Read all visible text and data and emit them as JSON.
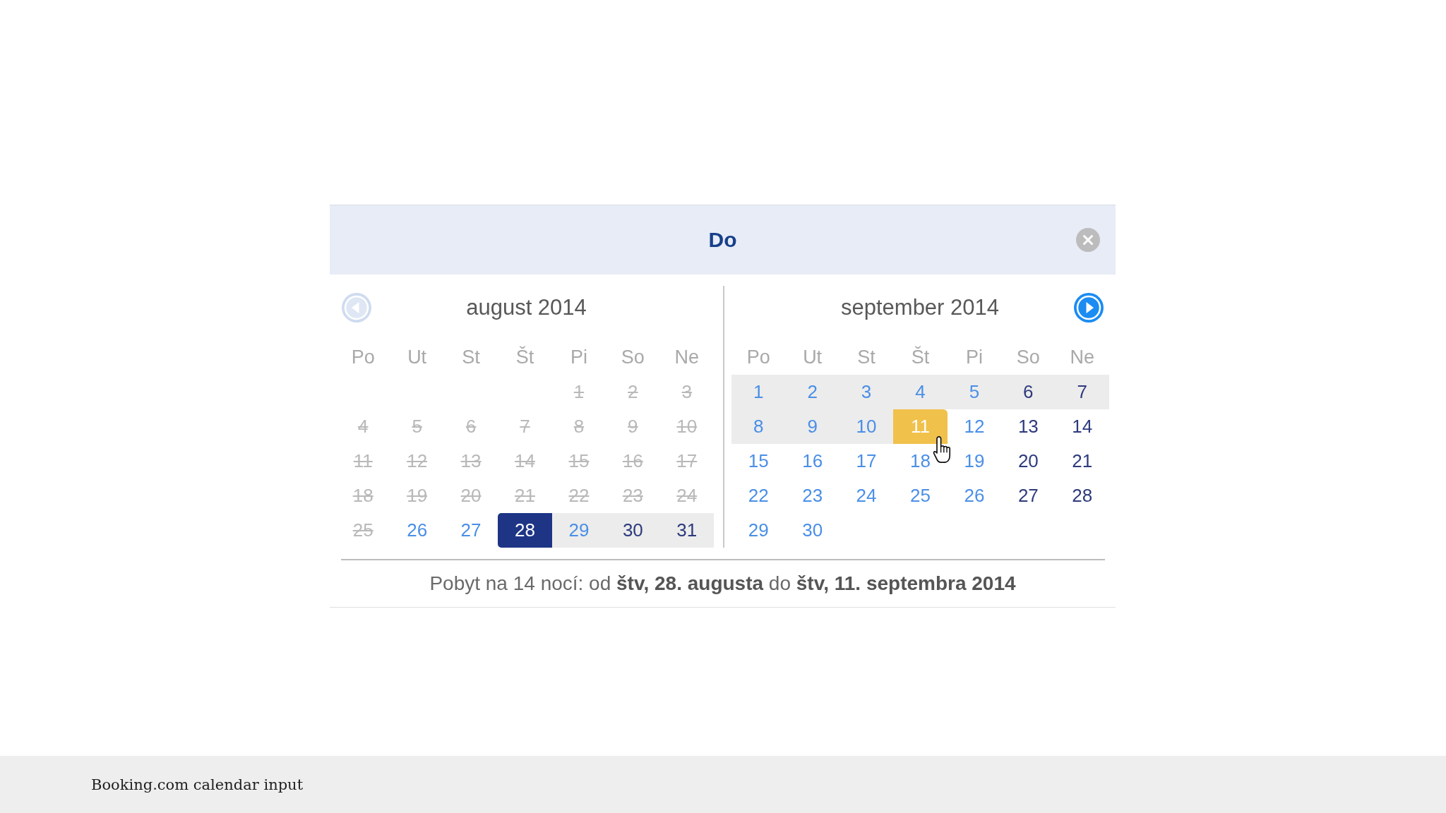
{
  "picker": {
    "title": "Do"
  },
  "navigation": {
    "previous": {
      "disabled": true
    },
    "next": {
      "disabled": false
    }
  },
  "months": [
    {
      "title": "august 2014",
      "weekdays": [
        "Po",
        "Ut",
        "St",
        "Št",
        "Pi",
        "So",
        "Ne"
      ],
      "weeks": [
        [
          {
            "day": "1",
            "kind": "past",
            "in_range": false
          },
          {
            "day": "2",
            "kind": "past",
            "in_range": false
          },
          {
            "day": "3",
            "kind": "past",
            "in_range": false
          }
        ],
        [
          {
            "day": "4",
            "kind": "past",
            "in_range": false
          },
          {
            "day": "5",
            "kind": "past",
            "in_range": false
          },
          {
            "day": "6",
            "kind": "past",
            "in_range": false
          },
          {
            "day": "7",
            "kind": "past",
            "in_range": false
          },
          {
            "day": "8",
            "kind": "past",
            "in_range": false
          },
          {
            "day": "9",
            "kind": "past",
            "in_range": false
          },
          {
            "day": "10",
            "kind": "past",
            "in_range": false
          }
        ],
        [
          {
            "day": "11",
            "kind": "past",
            "in_range": false
          },
          {
            "day": "12",
            "kind": "past",
            "in_range": false
          },
          {
            "day": "13",
            "kind": "past",
            "in_range": false
          },
          {
            "day": "14",
            "kind": "past",
            "in_range": false
          },
          {
            "day": "15",
            "kind": "past",
            "in_range": false
          },
          {
            "day": "16",
            "kind": "past",
            "in_range": false
          },
          {
            "day": "17",
            "kind": "past",
            "in_range": false
          }
        ],
        [
          {
            "day": "18",
            "kind": "past",
            "in_range": false
          },
          {
            "day": "19",
            "kind": "past",
            "in_range": false
          },
          {
            "day": "20",
            "kind": "past",
            "in_range": false
          },
          {
            "day": "21",
            "kind": "past",
            "in_range": false
          },
          {
            "day": "22",
            "kind": "past",
            "in_range": false
          },
          {
            "day": "23",
            "kind": "past",
            "in_range": false
          },
          {
            "day": "24",
            "kind": "past",
            "in_range": false
          }
        ],
        [
          {
            "day": "25",
            "kind": "past",
            "in_range": false
          },
          {
            "day": "26",
            "kind": "weekday",
            "in_range": false
          },
          {
            "day": "27",
            "kind": "weekday",
            "in_range": false
          },
          {
            "day": "28",
            "kind": "check_in"
          },
          {
            "day": "29",
            "kind": "weekday",
            "in_range": true
          },
          {
            "day": "30",
            "kind": "weekend",
            "in_range": true
          },
          {
            "day": "31",
            "kind": "weekend",
            "in_range": true
          }
        ]
      ]
    },
    {
      "title": "september 2014",
      "weekdays": [
        "Po",
        "Ut",
        "St",
        "Št",
        "Pi",
        "So",
        "Ne"
      ],
      "weeks": [
        [
          {
            "day": "1",
            "kind": "weekday",
            "in_range": true
          },
          {
            "day": "2",
            "kind": "weekday",
            "in_range": true
          },
          {
            "day": "3",
            "kind": "weekday",
            "in_range": true
          },
          {
            "day": "4",
            "kind": "weekday",
            "in_range": true
          },
          {
            "day": "5",
            "kind": "weekday",
            "in_range": true
          },
          {
            "day": "6",
            "kind": "weekend",
            "in_range": true
          },
          {
            "day": "7",
            "kind": "weekend",
            "in_range": true
          }
        ],
        [
          {
            "day": "8",
            "kind": "weekday",
            "in_range": true
          },
          {
            "day": "9",
            "kind": "weekday",
            "in_range": true
          },
          {
            "day": "10",
            "kind": "weekday",
            "in_range": true
          },
          {
            "day": "11",
            "kind": "check_out"
          },
          {
            "day": "12",
            "kind": "weekday",
            "in_range": false
          },
          {
            "day": "13",
            "kind": "weekend",
            "in_range": false
          },
          {
            "day": "14",
            "kind": "weekend",
            "in_range": false
          }
        ],
        [
          {
            "day": "15",
            "kind": "weekday",
            "in_range": false
          },
          {
            "day": "16",
            "kind": "weekday",
            "in_range": false
          },
          {
            "day": "17",
            "kind": "weekday",
            "in_range": false
          },
          {
            "day": "18",
            "kind": "weekday",
            "in_range": false
          },
          {
            "day": "19",
            "kind": "weekday",
            "in_range": false
          },
          {
            "day": "20",
            "kind": "weekend",
            "in_range": false
          },
          {
            "day": "21",
            "kind": "weekend",
            "in_range": false
          }
        ],
        [
          {
            "day": "22",
            "kind": "weekday",
            "in_range": false
          },
          {
            "day": "23",
            "kind": "weekday",
            "in_range": false
          },
          {
            "day": "24",
            "kind": "weekday",
            "in_range": false
          },
          {
            "day": "25",
            "kind": "weekday",
            "in_range": false
          },
          {
            "day": "26",
            "kind": "weekday",
            "in_range": false
          },
          {
            "day": "27",
            "kind": "weekend",
            "in_range": false
          },
          {
            "day": "28",
            "kind": "weekend",
            "in_range": false
          }
        ],
        [
          {
            "day": "29",
            "kind": "weekday",
            "in_range": false
          },
          {
            "day": "30",
            "kind": "weekday",
            "in_range": false
          }
        ]
      ]
    }
  ],
  "summary": "Pobyt na 14 nocí: od **štv, 28. augusta** do **štv, 11. septembra 2014**",
  "caption": "Booking.com calendar input"
}
